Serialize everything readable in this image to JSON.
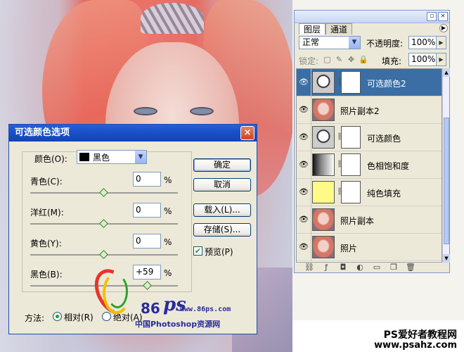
{
  "layers_panel": {
    "tab_layers": "图层",
    "tab_channels": "通道",
    "blend_mode": "正常",
    "opacity_label": "不透明度:",
    "opacity_value": "100%",
    "lock_label": "锁定:",
    "fill_label": "填充:",
    "fill_value": "100%",
    "layers": [
      {
        "name": "可选颜色2",
        "type": "adjustment",
        "selected": true
      },
      {
        "name": "照片副本2",
        "type": "photo",
        "selected": false
      },
      {
        "name": "可选颜色",
        "type": "adjustment",
        "selected": false
      },
      {
        "name": "色相饱和度",
        "type": "hue-saturation",
        "selected": false
      },
      {
        "name": "纯色填充",
        "type": "solid-fill",
        "selected": false
      },
      {
        "name": "照片副本",
        "type": "photo",
        "selected": false
      },
      {
        "name": "照片",
        "type": "photo",
        "selected": false
      }
    ]
  },
  "dialog": {
    "title": "可选颜色选项",
    "color_label": "颜色(O):",
    "color_value": "黑色",
    "sliders": [
      {
        "label": "青色(C):",
        "value": "0",
        "unit": "%",
        "level": 0.5
      },
      {
        "label": "洋红(M):",
        "value": "0",
        "unit": "%",
        "level": 0.5
      },
      {
        "label": "黄色(Y):",
        "value": "0",
        "unit": "%",
        "level": 0.5
      },
      {
        "label": "黑色(B):",
        "value": "+59",
        "unit": "%",
        "level": 0.795
      }
    ],
    "buttons": {
      "ok": "确定",
      "cancel": "取消",
      "load": "载入(L)...",
      "save": "存储(S)..."
    },
    "preview_label": "预览(P)",
    "method_label": "方法:",
    "method_relative": "相对(R)",
    "method_absolute": "绝对(A)"
  },
  "watermark": {
    "logo_num": "86",
    "logo_ps": "ps",
    "logo_url": "www.86ps.com",
    "logo_cn": "中国Photoshop资源网",
    "footer_line1": "PS爱好者教程网",
    "footer_line2": "www.psahz.com"
  }
}
